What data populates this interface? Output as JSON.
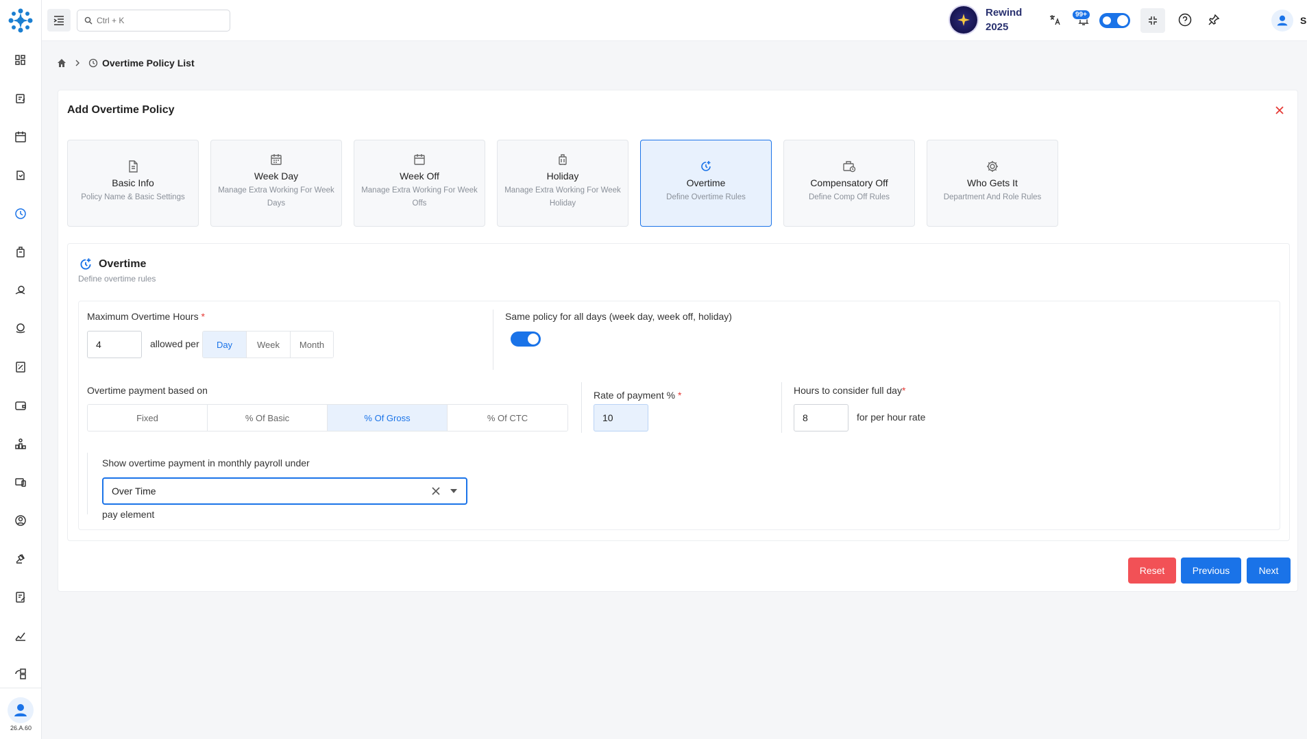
{
  "sidebar": {
    "items": [
      "dashboard-icon",
      "task-icon",
      "calendar-icon",
      "leave-icon",
      "clock-icon",
      "briefcase-icon",
      "hand-money-icon",
      "coins-icon",
      "report-icon",
      "wallet-icon",
      "org-chart-icon",
      "devices-icon",
      "user-circle-icon",
      "gavel-icon",
      "edit-doc-icon",
      "chart-icon",
      "apps-icon"
    ],
    "version": "26.A.60"
  },
  "topbar": {
    "search_placeholder": "Ctrl + K",
    "rewind_line1": "Rewind",
    "rewind_line2": "2025",
    "notification_count": "99+",
    "user_name": "Support"
  },
  "breadcrumb": {
    "current": "Overtime Policy List"
  },
  "page": {
    "title": "Add Overtime Policy"
  },
  "steps": [
    {
      "title": "Basic Info",
      "sub": "Policy Name & Basic Settings",
      "icon": "document-icon"
    },
    {
      "title": "Week Day",
      "sub": "Manage Extra Working For Week Days",
      "icon": "calendar-grid-icon"
    },
    {
      "title": "Week Off",
      "sub": "Manage Extra Working For Week Offs",
      "icon": "calendar-icon"
    },
    {
      "title": "Holiday",
      "sub": "Manage Extra Working For Week Holiday",
      "icon": "luggage-icon"
    },
    {
      "title": "Overtime",
      "sub": "Define Overtime Rules",
      "icon": "clock-plus-icon"
    },
    {
      "title": "Compensatory Off",
      "sub": "Define Comp Off Rules",
      "icon": "briefcase-clock-icon"
    },
    {
      "title": "Who Gets It",
      "sub": "Department And Role Rules",
      "icon": "gear-icon"
    }
  ],
  "section": {
    "title": "Overtime",
    "subtitle": "Define overtime rules"
  },
  "form": {
    "max_hours_label": "Maximum Overtime Hours",
    "required_mark": "*",
    "max_hours_value": "4",
    "allowed_per": "allowed per",
    "period_options": [
      "Day",
      "Week",
      "Month"
    ],
    "period_selected": "Day",
    "same_policy_label": "Same policy for all days (week day, week off, holiday)",
    "same_policy_on": true,
    "payment_based_label": "Overtime payment based on",
    "payment_options": [
      "Fixed",
      "% Of Basic",
      "% Of Gross",
      "% Of CTC"
    ],
    "payment_selected": "% Of Gross",
    "rate_label": "Rate of payment %",
    "rate_value": "10",
    "full_day_label": "Hours to consider full day",
    "full_day_value": "8",
    "per_hour_text": "for per hour rate",
    "payroll_label": "Show overtime payment in monthly payroll under",
    "payroll_value": "Over Time",
    "pay_element_text": "pay element"
  },
  "buttons": {
    "reset": "Reset",
    "previous": "Previous",
    "next": "Next"
  },
  "colors": {
    "primary": "#1a73e8",
    "danger": "#f25156",
    "selected_bg": "#e8f1fd"
  }
}
